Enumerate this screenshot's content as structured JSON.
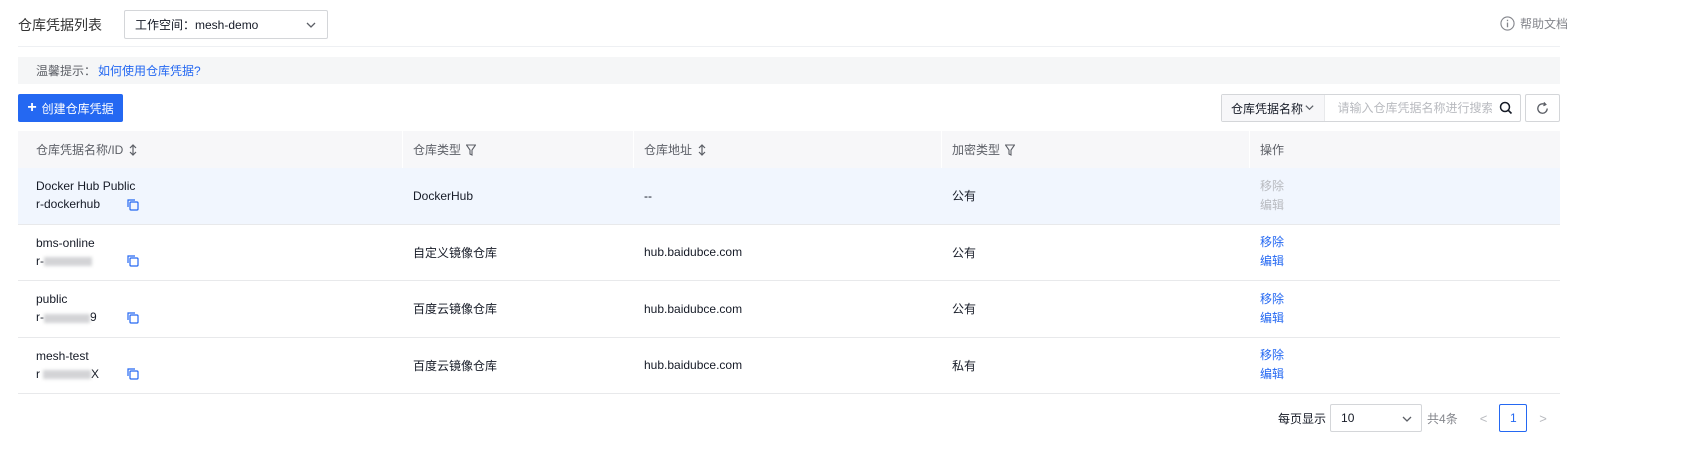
{
  "header": {
    "title": "仓库凭据列表",
    "workspace_label": "工作空间：mesh-demo",
    "help_label": "帮助文档"
  },
  "tips": {
    "label": "温馨提示：",
    "link": "如何使用仓库凭据?"
  },
  "toolbar": {
    "create_label": "创建仓库凭据",
    "search_type": "仓库凭据名称",
    "search_placeholder": "请输入仓库凭据名称进行搜索"
  },
  "table": {
    "columns": [
      "仓库凭据名称/ID",
      "仓库类型",
      "仓库地址",
      "加密类型",
      "操作"
    ],
    "rows": [
      {
        "name": "Docker Hub Public",
        "id_prefix": "r-dockerhub",
        "id_suffix": "",
        "type": "DockerHub",
        "address": "--",
        "encryption": "公有",
        "remove": "移除",
        "edit": "编辑",
        "disabled": true
      },
      {
        "name": "bms-online",
        "id_prefix": "r-",
        "id_suffix": "",
        "type": "自定义镜像仓库",
        "address": "hub.baidubce.com",
        "encryption": "公有",
        "remove": "移除",
        "edit": "编辑",
        "disabled": false
      },
      {
        "name": "public",
        "id_prefix": "r-",
        "id_suffix": "9",
        "type": "百度云镜像仓库",
        "address": "hub.baidubce.com",
        "encryption": "公有",
        "remove": "移除",
        "edit": "编辑",
        "disabled": false
      },
      {
        "name": "mesh-test",
        "id_prefix": "r",
        "id_suffix": "X",
        "type": "百度云镜像仓库",
        "address": "hub.baidubce.com",
        "encryption": "私有",
        "remove": "移除",
        "edit": "编辑",
        "disabled": false
      }
    ]
  },
  "pager": {
    "page_size_label": "每页显示",
    "page_size": "10",
    "total": "共4条",
    "prev": "<",
    "current": "1",
    "next": ">"
  },
  "colors": {
    "primary": "#2468f2",
    "header_bg": "#f7f7f9",
    "hover_row": "#f1f6fe"
  }
}
